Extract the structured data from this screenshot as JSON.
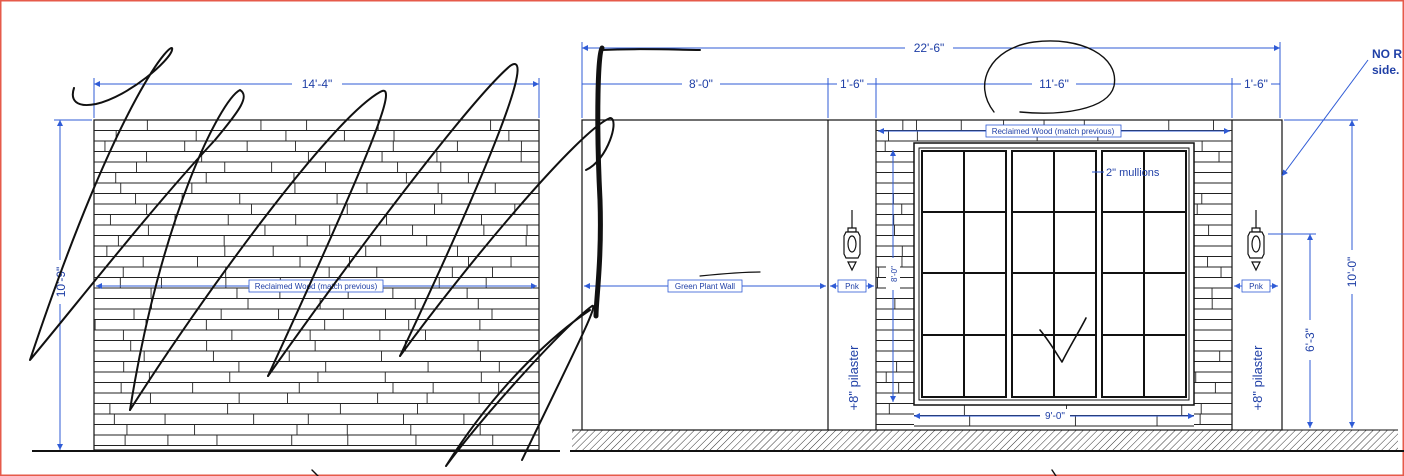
{
  "colors": {
    "frame_border": "#e65a4a",
    "dimension_blue": "#1f3fa6",
    "line_black": "#111111"
  },
  "left_wall": {
    "width_dim": "14'-4\"",
    "height_dim": "10'-9\"",
    "material_label": "Reclaimed Wood (match previous)"
  },
  "right_elevation": {
    "overall_dim": "22'-6\"",
    "segment_dims": [
      "8'-0\"",
      "1'-6\"",
      "11'-6\"",
      "1'-6\""
    ],
    "top_material_label": "Reclaimed Wood (match previous)",
    "plant_wall_label": "Green Plant Wall",
    "pilaster_label": "+8\" pilaster",
    "pnk_label": "Pnk",
    "mullions_note": "2\" mullions",
    "door_height_dim": "8'-0\"",
    "door_width_dim": "9'-0\"",
    "light_height_dim": "6'-3\"",
    "wall_height_dim": "10'-0\""
  },
  "side_note": {
    "line1": "NO R",
    "line2": "side."
  }
}
